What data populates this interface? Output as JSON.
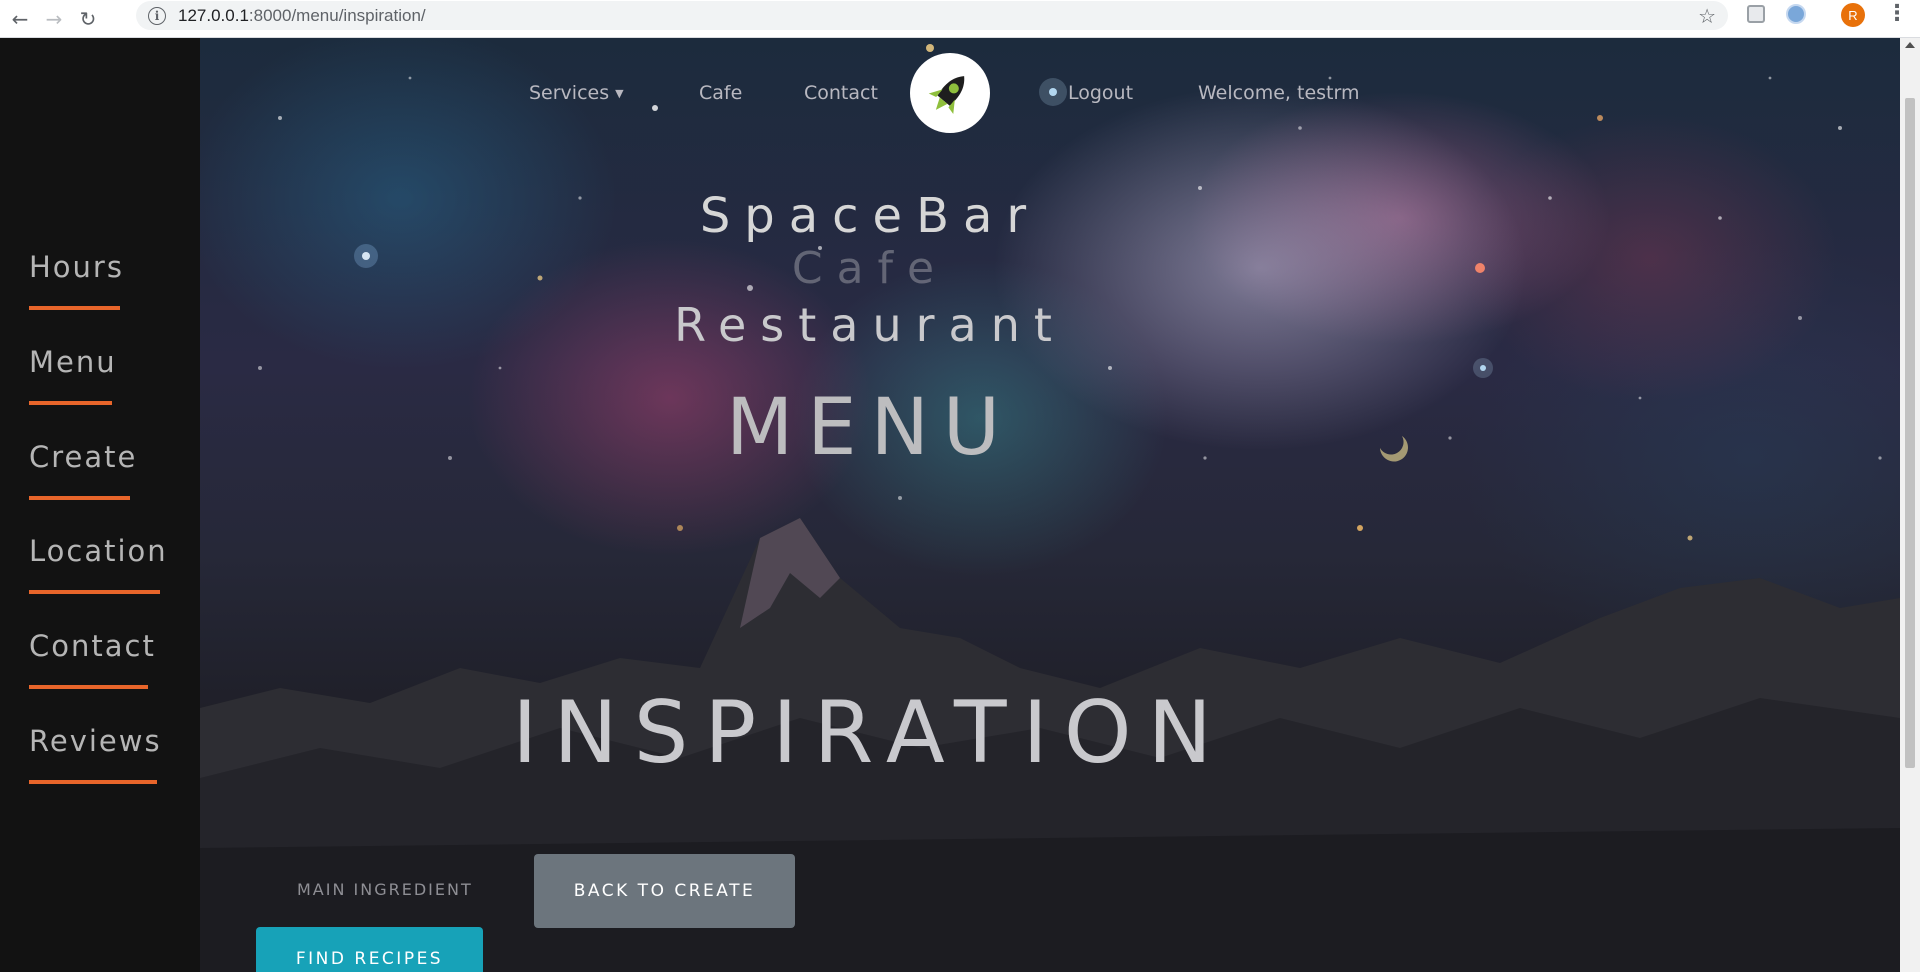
{
  "browser": {
    "url_host": "127.0.0.1",
    "url_path": ":8000/menu/inspiration/",
    "profile_initial": "R",
    "icons": {
      "back": "arrow-left-icon",
      "forward": "arrow-right-icon",
      "reload": "reload-icon",
      "info": "info-icon",
      "bookmark": "star-icon",
      "menu": "more-vert-icon"
    }
  },
  "sidebar": {
    "items": [
      {
        "label": "Hours"
      },
      {
        "label": "Menu"
      },
      {
        "label": "Create"
      },
      {
        "label": "Location"
      },
      {
        "label": "Contact"
      },
      {
        "label": "Reviews"
      }
    ],
    "accent_color": "#e8652a"
  },
  "topnav": {
    "services": "Services",
    "cafe": "Cafe",
    "contact": "Contact",
    "logout": "Logout",
    "welcome": "Welcome, testrm"
  },
  "hero": {
    "line1": "SpaceBar",
    "line2": "Cafe",
    "line3": "Restaurant",
    "section": "MENU",
    "heading": "INSPIRATION"
  },
  "form": {
    "main_ingredient_label": "MAIN INGREDIENT",
    "back_button": "BACK TO CREATE",
    "find_button": "FIND RECIPES",
    "back_color": "#6c757d",
    "find_color": "#17a2b8"
  }
}
